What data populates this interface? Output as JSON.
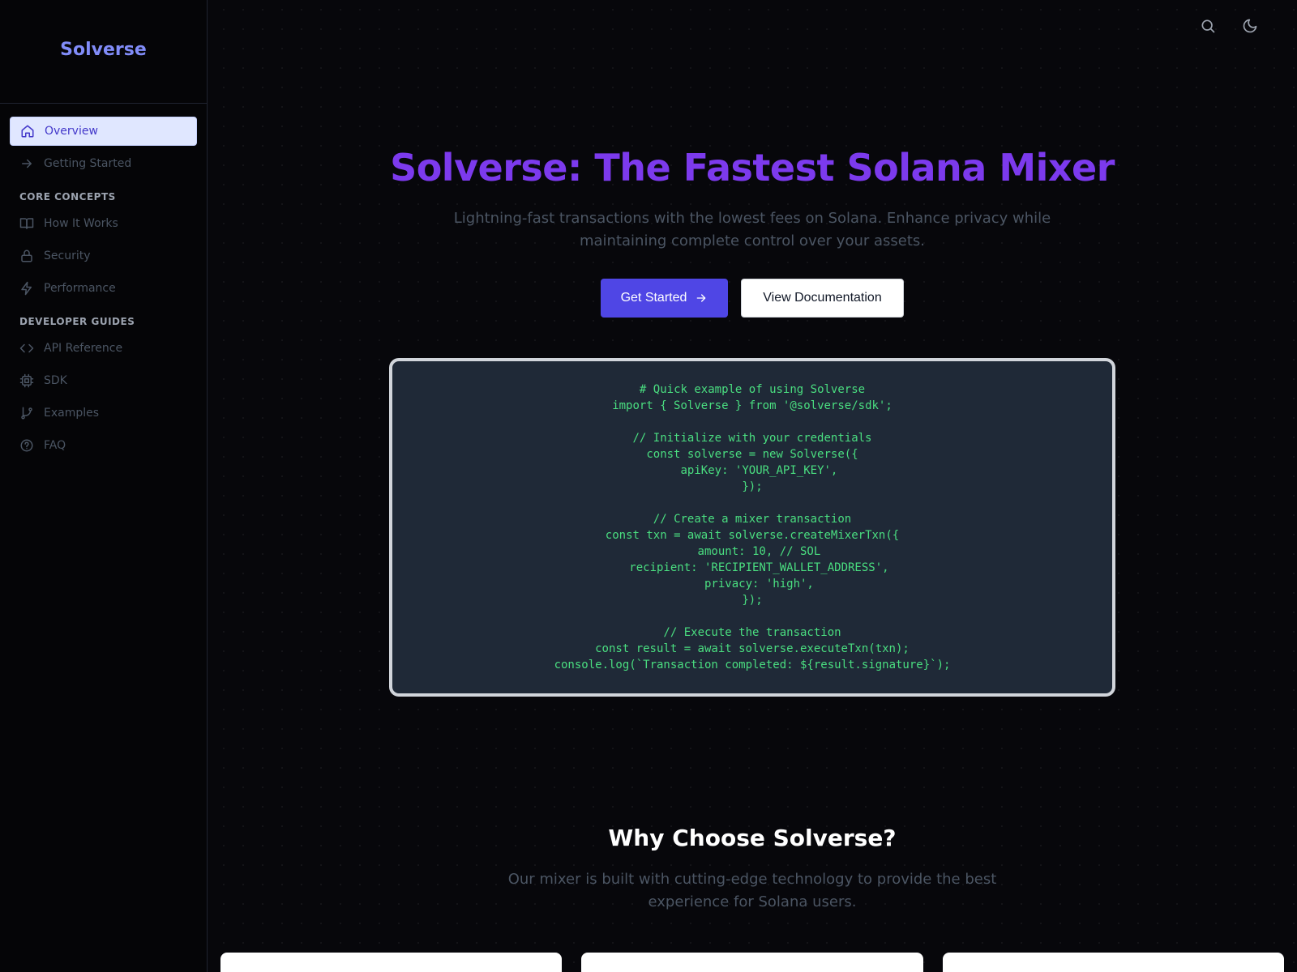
{
  "sidebar": {
    "brand": "Solverse",
    "top_items": [
      {
        "label": "Overview",
        "icon": "home-icon",
        "active": true
      },
      {
        "label": "Getting Started",
        "icon": "arrow-right-icon"
      }
    ],
    "sections": [
      {
        "title": "CORE CONCEPTS",
        "items": [
          {
            "label": "How It Works",
            "icon": "book-icon"
          },
          {
            "label": "Security",
            "icon": "lock-icon"
          },
          {
            "label": "Performance",
            "icon": "lightning-icon"
          }
        ]
      },
      {
        "title": "DEVELOPER GUIDES",
        "items": [
          {
            "label": "API Reference",
            "icon": "code-icon"
          },
          {
            "label": "SDK",
            "icon": "cpu-icon"
          },
          {
            "label": "Examples",
            "icon": "git-branch-icon"
          },
          {
            "label": "FAQ",
            "icon": "help-circle-icon"
          }
        ]
      }
    ]
  },
  "topbar": {
    "search_icon": "search-icon",
    "theme_icon": "moon-icon"
  },
  "hero": {
    "title": "Solverse: The Fastest Solana Mixer",
    "subtitle": "Lightning-fast transactions with the lowest fees on Solana. Enhance privacy while maintaining complete control over your assets.",
    "primary_button": "Get Started",
    "secondary_button": "View Documentation"
  },
  "code_example": "# Quick example of using Solverse\nimport { Solverse } from '@solverse/sdk';\n\n// Initialize with your credentials\nconst solverse = new Solverse({\n  apiKey: 'YOUR_API_KEY',\n});\n\n// Create a mixer transaction\nconst txn = await solverse.createMixerTxn({\n  amount: 10, // SOL\n  recipient: 'RECIPIENT_WALLET_ADDRESS',\n  privacy: 'high',\n});\n\n// Execute the transaction\nconst result = await solverse.executeTxn(txn);\nconsole.log(`Transaction completed: ${result.signature}`);",
  "why": {
    "title": "Why Choose Solverse?",
    "subtitle": "Our mixer is built with cutting-edge technology to provide the best experience for Solana users."
  },
  "colors": {
    "accent": "#4f46e5",
    "title": "#7c3aed",
    "brand": "#818cf8",
    "code_text": "#4ade80"
  }
}
